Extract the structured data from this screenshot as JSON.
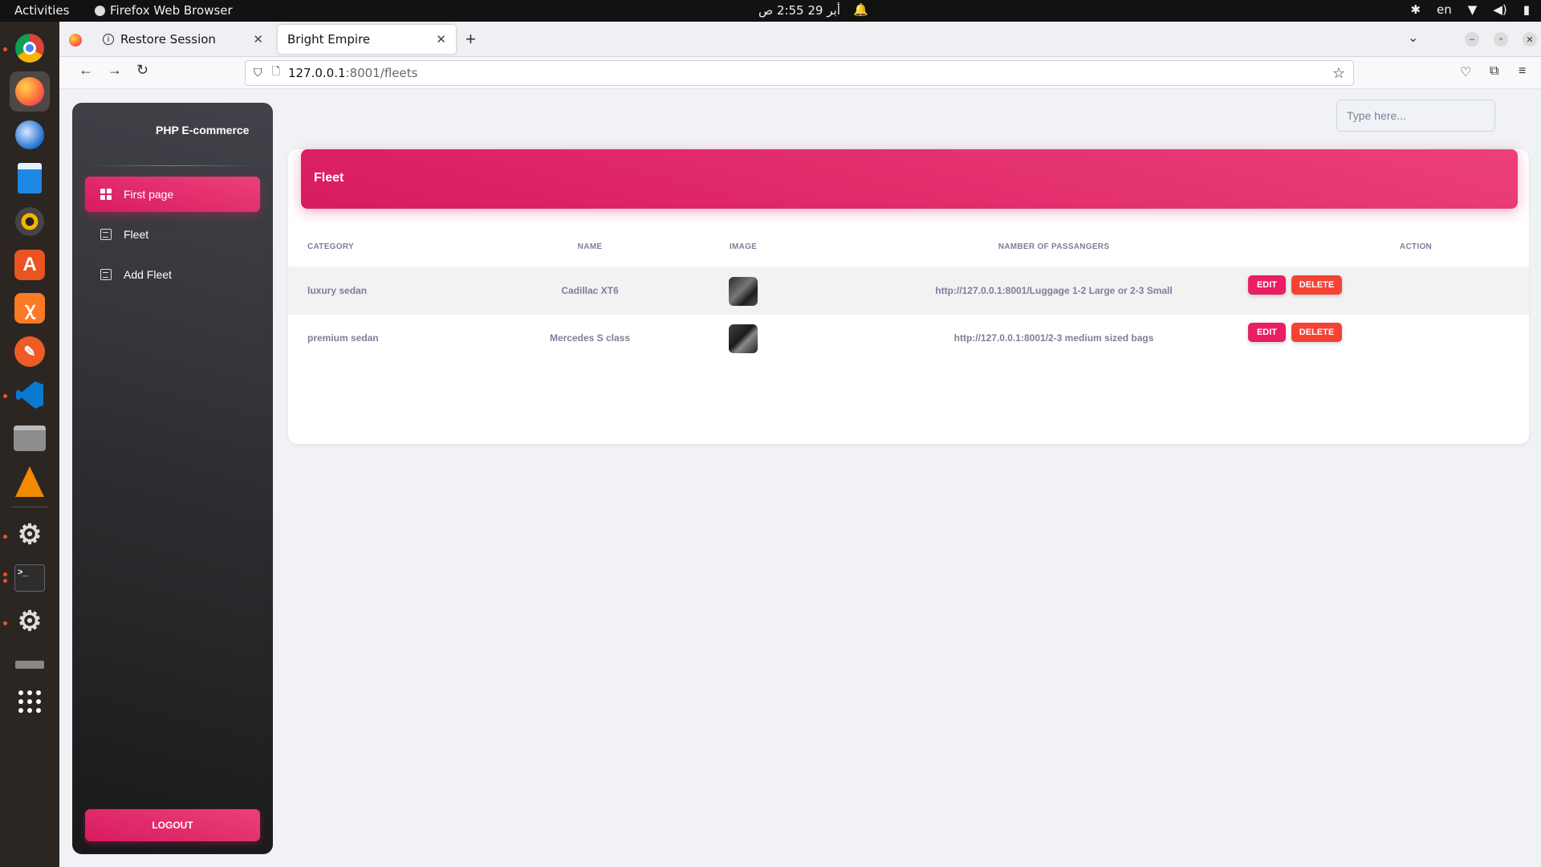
{
  "os": {
    "activities": "Activities",
    "app_name": "Firefox Web Browser",
    "clock": "أبر 29  2:55 ص",
    "language": "en"
  },
  "browser": {
    "tabs": [
      {
        "label": "Restore Session"
      },
      {
        "label": "Bright Empire"
      }
    ],
    "url_host": "127.0.0.1",
    "url_path": ":8001/fleets"
  },
  "sidebar": {
    "brand": "PHP E-commerce",
    "items": [
      {
        "label": "First page"
      },
      {
        "label": "Fleet"
      },
      {
        "label": "Add Fleet"
      }
    ],
    "logout": "LOGOUT"
  },
  "search": {
    "placeholder": "Type here..."
  },
  "card": {
    "title": "Fleet",
    "columns": [
      "CATEGORY",
      "NAME",
      "IMAGE",
      "NAMBER OF PASSANGERS",
      "ACTION"
    ],
    "rows": [
      {
        "category": "luxury sedan",
        "name": "Cadillac XT6",
        "passengers": "http://127.0.0.1:8001/Luggage 1-2 Large or 2-3 Small",
        "edit": "EDIT",
        "delete": "DELETE"
      },
      {
        "category": "premium sedan",
        "name": "Mercedes S class",
        "passengers": "http://127.0.0.1:8001/2-3 medium sized bags",
        "edit": "EDIT",
        "delete": "DELETE"
      }
    ]
  },
  "colors": {
    "accent": "#e91e63",
    "delete": "#f44335",
    "sidebar_dark": "#191919"
  }
}
